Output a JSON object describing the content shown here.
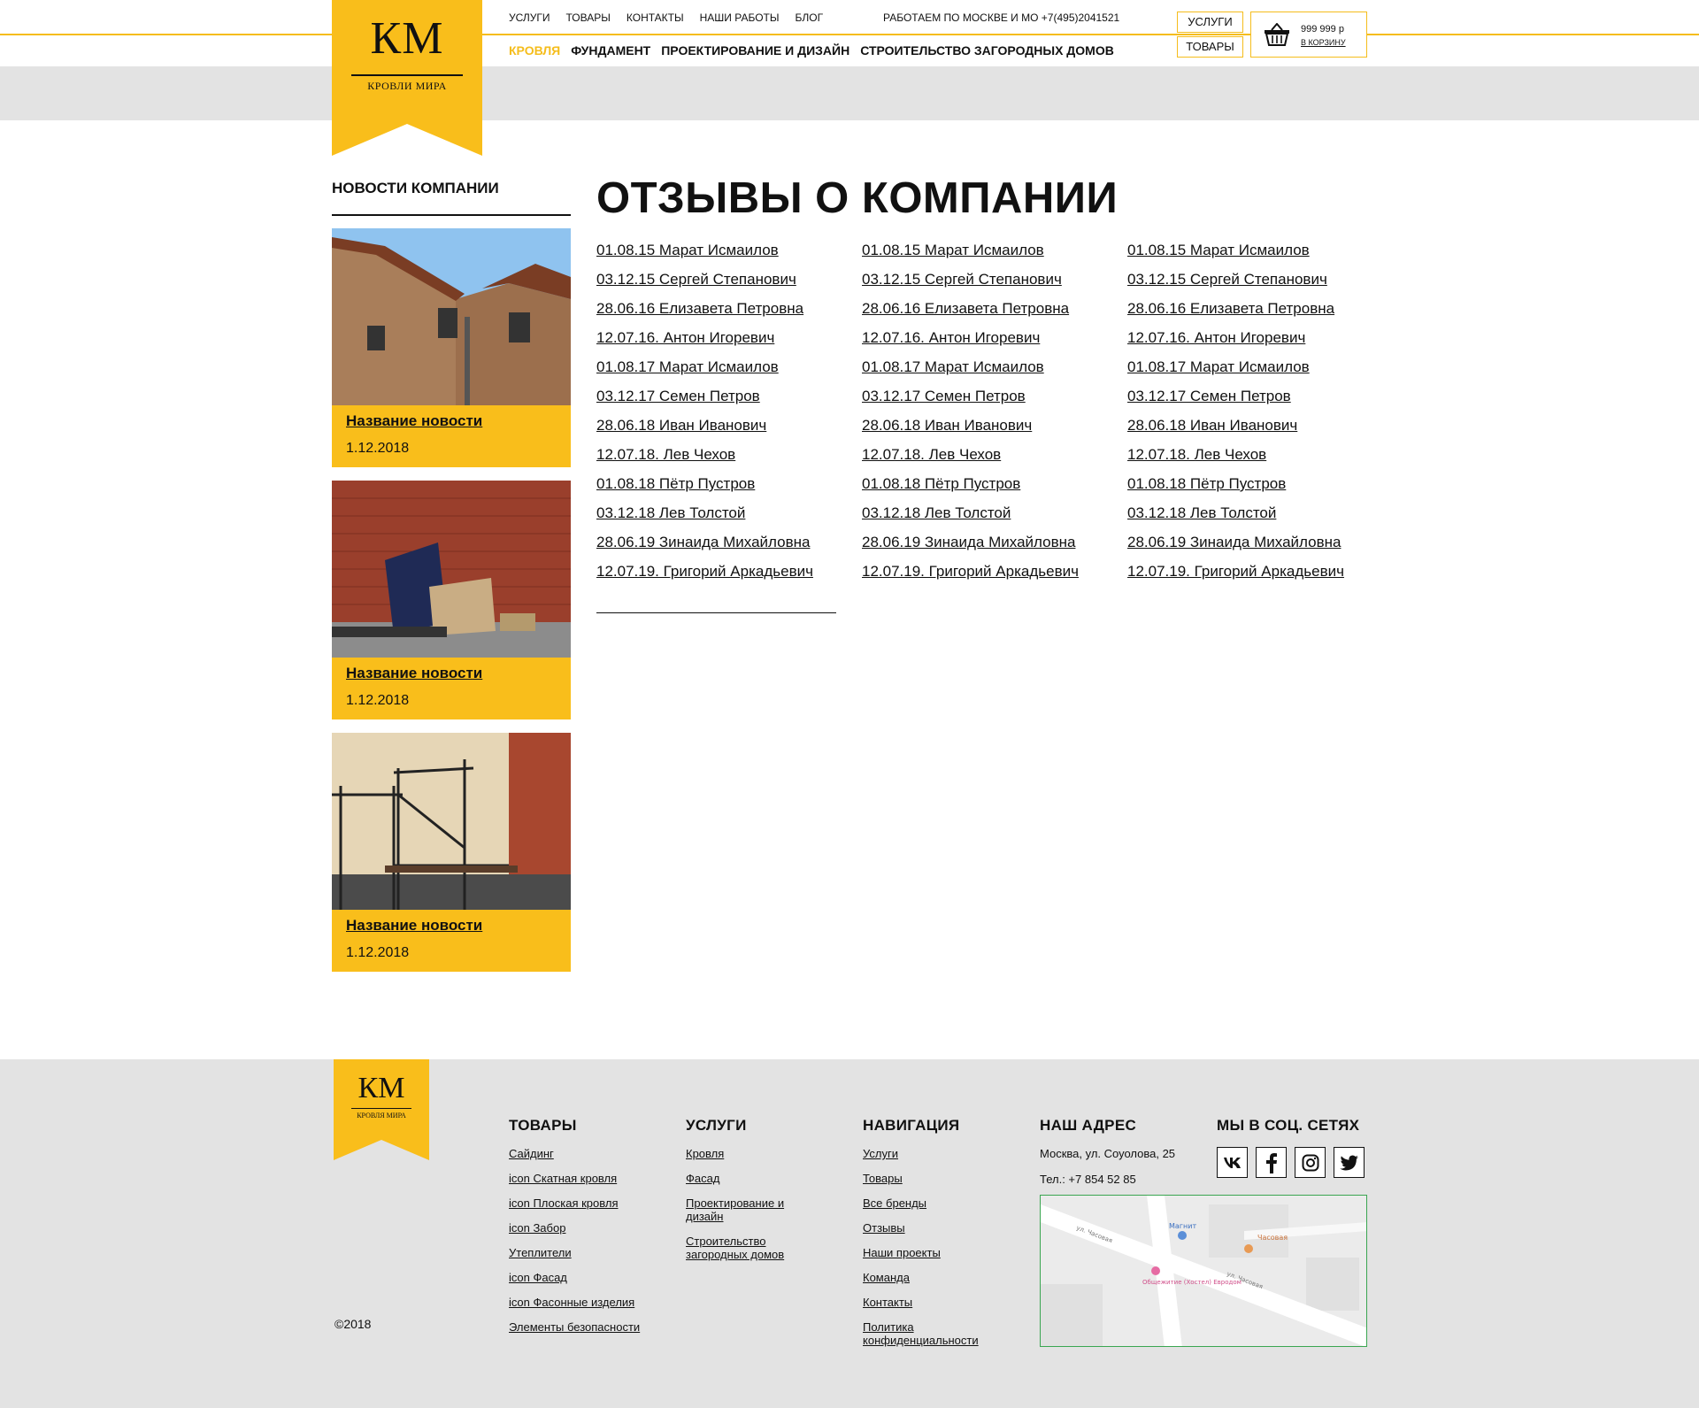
{
  "header": {
    "logo": {
      "mark": "КМ",
      "subtitle": "КРОВЛИ МИРА"
    },
    "top_nav": [
      "УСЛУГИ",
      "ТОВАРЫ",
      "КОНТАКТЫ",
      "НАШИ РАБОТЫ",
      "БЛОГ"
    ],
    "phone_text": "РАБОТАЕМ ПО МОСКВЕ И МО +7(495)2041521",
    "main_nav": [
      "КРОВЛЯ",
      "ФУНДАМЕНТ",
      "ПРОЕКТИРОВАНИЕ И ДИЗАЙН",
      "СТРОИТЕЛЬСТВО ЗАГОРОДНЫХ ДОМОВ"
    ],
    "active_main_nav": "КРОВЛЯ",
    "buttons": {
      "services": "УСЛУГИ",
      "goods": "ТОВАРЫ"
    },
    "cart": {
      "price": "999 999 р",
      "link": "В КОРЗИНУ",
      "icon": "basket-icon"
    }
  },
  "sidebar": {
    "title": "НОВОСТИ КОМПАНИИ",
    "news": [
      {
        "title": "Название новости",
        "date": "1.12.2018"
      },
      {
        "title": "Название новости",
        "date": "1.12.2018"
      },
      {
        "title": "Название новости",
        "date": "1.12.2018"
      }
    ]
  },
  "main": {
    "title": "ОТЗЫВЫ О КОМПАНИИ",
    "reviews": [
      "01.08.15 Марат Исмаилов",
      "03.12.15 Сергей Степанович",
      "28.06.16 Елизавета Петровна",
      "12.07.16. Антон Игоревич",
      "01.08.17 Марат Исмаилов",
      "03.12.17 Семен Петров",
      "28.06.18 Иван Иванович",
      "12.07.18. Лев Чехов",
      "01.08.18 Пётр Пустров",
      "03.12.18 Лев Толстой",
      "28.06.19 Зинаида Михайловна",
      "12.07.19. Григорий Аркадьевич"
    ]
  },
  "footer": {
    "logo": {
      "mark": "КМ",
      "subtitle": "КРОВЛЯ МИРА"
    },
    "copyright": "©2018",
    "goods": {
      "title": "ТОВАРЫ",
      "links": [
        "Сайдинг",
        "icon Скатная кровля",
        "icon Плоская кровля",
        "icon Забор",
        "Утеплители",
        "icon Фасад",
        "icon Фасонные изделия",
        "Элементы безопасности"
      ]
    },
    "services": {
      "title": "УСЛУГИ",
      "links": [
        "Кровля",
        "Фасад",
        "Проектирование и дизайн",
        "Строительство загородных домов"
      ]
    },
    "navigation": {
      "title": "НАВИГАЦИЯ",
      "links": [
        "Услуги",
        "Товары",
        "Все бренды",
        "Отзывы",
        "Наши проекты",
        "Команда",
        "Контакты",
        "Политика конфиденциальности"
      ]
    },
    "address": {
      "title": "НАШ АДРЕС",
      "street": "Москва, ул. Соуолова, 25",
      "phone": "Тел.: +7 854 52 85"
    },
    "social": {
      "title": "МЫ В СОЦ. СЕТЯХ",
      "icons": [
        "vk-icon",
        "facebook-icon",
        "instagram-icon",
        "twitter-icon"
      ]
    },
    "map": {
      "labels": [
        "Магнит",
        "Часовая",
        "Общежитие (Хостел) Евродом",
        "ул. Часовая",
        "ул. Часовая"
      ]
    }
  },
  "colors": {
    "accent": "#f9be1b",
    "line": "#f5bd1c",
    "gray": "#e3e3e3",
    "text": "#111111"
  }
}
